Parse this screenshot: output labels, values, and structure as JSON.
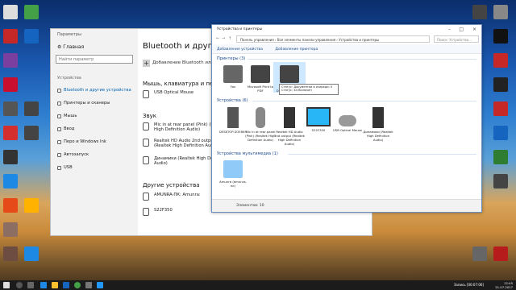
{
  "colors": {
    "accent": "#0063b1",
    "taskbar": "#1b1b1b",
    "link": "#1e4a8f"
  },
  "settings": {
    "title": "Параметры",
    "home": "Главная",
    "search_placeholder": "Найти параметр",
    "category": "Устройства",
    "nav": [
      {
        "label": "Bluetooth и другие устройства",
        "icon": "bluetooth-icon",
        "active": true
      },
      {
        "label": "Принтеры и сканеры",
        "icon": "printer-icon"
      },
      {
        "label": "Мышь",
        "icon": "mouse-icon"
      },
      {
        "label": "Ввод",
        "icon": "keyboard-icon"
      },
      {
        "label": "Перо и Windows Ink",
        "icon": "pen-icon"
      },
      {
        "label": "Автозапуск",
        "icon": "autoplay-icon"
      },
      {
        "label": "USB",
        "icon": "usb-icon"
      }
    ],
    "heading": "Bluetooth и другие устройства",
    "add_label": "Добавление Bluetooth или другого устройства",
    "section_mouse": "Мышь, клавиатура и перо",
    "mouse_device": "USB Optical Mouse",
    "section_sound": "Звук",
    "sound_devices": [
      "Mic in at rear panel (Pink) (Realtek High Definition Audio)",
      "Realtek HD Audio 2nd output (Realtek High Definition Audio)",
      "Динамики (Realtek High Definition Audio)"
    ],
    "section_other": "Другие устройства",
    "other_devices": [
      "AMUNRA-ПК: Amunra:",
      "S22F350"
    ]
  },
  "explorer": {
    "title": "Устройства и принтеры",
    "address": "Панель управления › Все элементы панели управления › Устройства и принтеры",
    "search_placeholder": "Поиск: Устройства...",
    "toolbar": [
      "Добавление устройства",
      "Добавление принтера"
    ],
    "group_printers": "Принтеры (3)",
    "printers": [
      {
        "label": "Fax",
        "icon": "fax-icon"
      },
      {
        "label": "Microsoft Print to PDF",
        "icon": "printer-icon"
      },
      {
        "label": "Microsoft XPS Document Writer",
        "icon": "printer-icon"
      }
    ],
    "tooltip_line1": "Статус: Документов в очереди: 0",
    "tooltip_line2": "Статус: 44 Включен",
    "group_devices": "Устройства (6)",
    "devices": [
      {
        "label": "DESKTOP-SOE6KS",
        "icon": "computer-icon"
      },
      {
        "label": "Mic in at rear panel (Pink) (Realtek High Definition Audio)",
        "icon": "microphone-icon"
      },
      {
        "label": "Realtek HD Audio 2nd output (Realtek High Definition Audio)",
        "icon": "speaker-icon"
      },
      {
        "label": "S22F350",
        "icon": "monitor-icon"
      },
      {
        "label": "USB Optical Mouse",
        "icon": "mouse-icon"
      },
      {
        "label": "Динамики (Realtek High Definition Audio)",
        "icon": "speaker-icon"
      }
    ],
    "group_media": "Устройства мультимедиа (1)",
    "media": [
      {
        "label": "Amunra (amunra-пк)",
        "icon": "media-device-icon"
      }
    ],
    "status": "Элементов: 10"
  },
  "taskbar": {
    "lang": "Запись [00:07:06]",
    "time": "12:45",
    "date": "21.07.2017"
  }
}
